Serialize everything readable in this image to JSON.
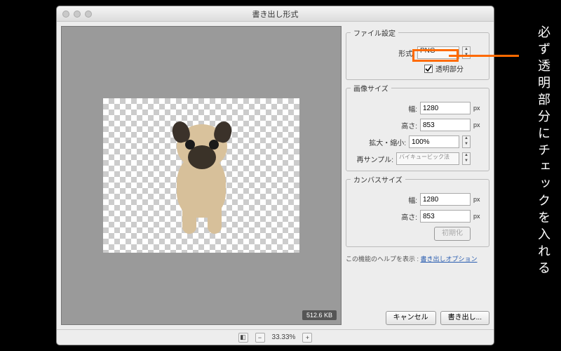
{
  "dialog": {
    "title": "書き出し形式",
    "zoom": {
      "level": "33.33%"
    },
    "filesize": "512.6 KB"
  },
  "fileSettings": {
    "legend": "ファイル設定",
    "formatLabel": "形式:",
    "formatValue": "PNG",
    "transparencyLabel": "透明部分",
    "transparencyChecked": true
  },
  "imageSize": {
    "legend": "画像サイズ",
    "widthLabel": "幅:",
    "widthValue": "1280",
    "heightLabel": "高さ:",
    "heightValue": "853",
    "scaleLabel": "拡大・縮小:",
    "scaleValue": "100%",
    "resampleLabel": "再サンプル:",
    "resampleValue": "バイキュービック法",
    "unit": "px"
  },
  "canvasSize": {
    "legend": "カンバスサイズ",
    "widthLabel": "幅:",
    "widthValue": "1280",
    "heightLabel": "高さ:",
    "heightValue": "853",
    "unit": "px",
    "resetLabel": "初期化"
  },
  "help": {
    "prefix": "この機能のヘルプを表示 : ",
    "link": "書き出しオプション"
  },
  "buttons": {
    "cancel": "キャンセル",
    "export": "書き出し..."
  },
  "annotation": {
    "text": "必ず透明部分にチェックを入れる"
  }
}
